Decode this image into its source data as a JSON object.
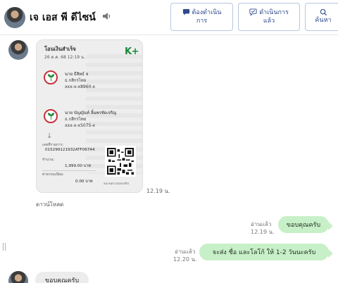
{
  "header": {
    "contact_name": "เจ เอส พี ดีไซน์",
    "buttons": {
      "todo_line1": "ต้องดำเนิน",
      "todo_line2": "การ",
      "done_line1": "ดำเนินการ",
      "done_line2": "แล้ว",
      "search": "ค้นหา"
    }
  },
  "slip": {
    "title": "โอนเงินสำเร็จ",
    "date": "26 ต.ค. 68  12:19 น.",
    "brand": "K+",
    "from": {
      "name": "นาย ธีสิทธ์ จ",
      "bank": "ธ.กสิกรไทย",
      "account": "xxx-x-x8960-x"
    },
    "to": {
      "name": "นาย บัญญันท์ ลิ้มพรชัยเจริญ",
      "bank": "ธ.กสิกรไทย",
      "account": "xxx-x-x5075-x"
    },
    "ref_label": "เลขที่รายการ:",
    "ref_value": "015299121932ATF06744",
    "amount_label": "จำนวน:",
    "amount_value": "1,999.00 บาท",
    "fee_label": "ค่าธรรมเนียม:",
    "fee_value": "0.00 บาท",
    "qr_caption": "สแกนตรวจสอบสลิป"
  },
  "messages": {
    "slip_time": "12.19 น.",
    "download": "ดาวน์โหลด",
    "out1": {
      "text": "ขอบคุณครับ",
      "read": "อ่านแล้ว",
      "time": "12.19 น."
    },
    "out2": {
      "text": "จะส่ง ชื่อ และโลโก้ ให้ 1-2 วันนะครับ",
      "read": "อ่านแล้ว",
      "time": "12.20 น."
    },
    "in1": {
      "text": "ขอบคุณครับ"
    }
  },
  "colors": {
    "outgoing_bubble": "#c8f0c8",
    "incoming_bubble": "#ececec",
    "button_text": "#2c4a8a",
    "kplus_green": "#1a8a3a",
    "kbank_red": "#c8323c"
  }
}
